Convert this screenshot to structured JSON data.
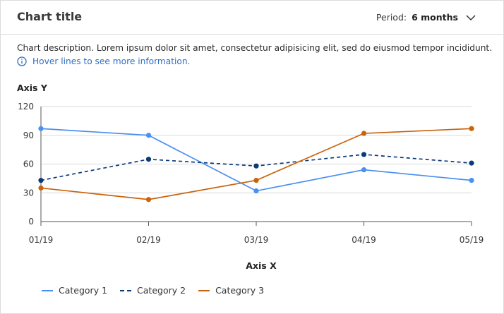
{
  "header": {
    "title": "Chart title",
    "period_label": "Period:",
    "period_value": "6 months"
  },
  "description": "Chart description. Lorem ipsum dolor sit amet, consectetur adipisicing elit, sed do eiusmod tempor incididunt.",
  "hint": "Hover lines to see more information.",
  "colors": {
    "category1": "#4a90f0",
    "category2": "#0b3a78",
    "category3": "#c8620c",
    "hint": "#2f6fc4",
    "grid": "#d9d9d9",
    "axis": "#555555"
  },
  "chart_data": {
    "type": "line",
    "x": [
      "01/19",
      "02/19",
      "03/19",
      "04/19",
      "05/19"
    ],
    "xlabel": "Axis X",
    "ylabel": "Axis Y",
    "ylim": [
      0,
      120
    ],
    "yticks": [
      0,
      30,
      60,
      90,
      120
    ],
    "grid": true,
    "legend_position": "bottom-left",
    "series": [
      {
        "name": "Category 1",
        "style": "solid",
        "values": [
          97,
          90,
          32,
          54,
          43
        ]
      },
      {
        "name": "Category 2",
        "style": "dashed",
        "values": [
          43,
          65,
          58,
          70,
          61
        ]
      },
      {
        "name": "Category 3",
        "style": "solid",
        "values": [
          35,
          23,
          43,
          92,
          97
        ]
      }
    ]
  }
}
